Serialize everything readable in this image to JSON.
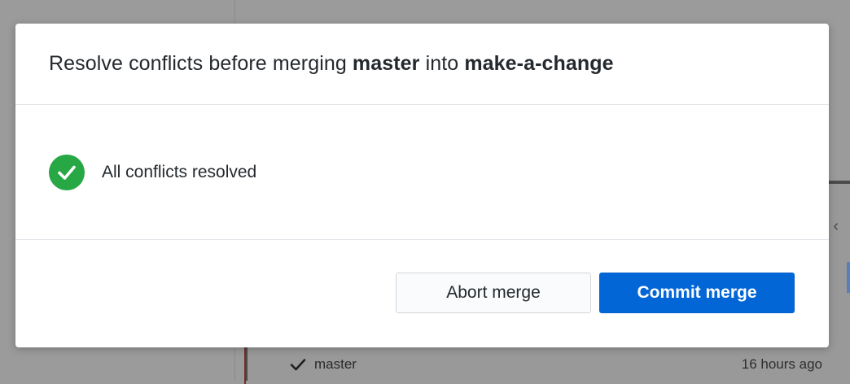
{
  "dialog": {
    "title_prefix": "Resolve conflicts before merging",
    "source_branch": "master",
    "title_middle": "into",
    "target_branch": "make-a-change",
    "status_icon": "check-circle-icon",
    "status_text": "All conflicts resolved",
    "abort_label": "Abort merge",
    "commit_label": "Commit merge"
  },
  "background": {
    "branch_name": "master",
    "branch_time": "16 hours ago",
    "chevron_icon": "chevron-left-icon",
    "check_icon": "check-icon"
  },
  "colors": {
    "success": "#28a745",
    "primary": "#0366d6",
    "overlay": "#9b9b9b"
  }
}
